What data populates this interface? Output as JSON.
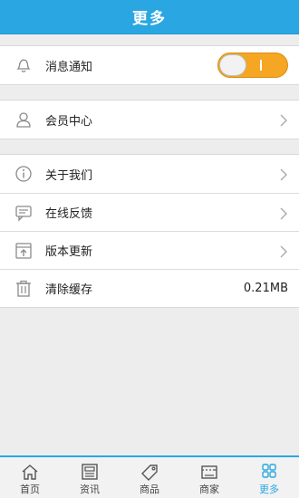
{
  "header": {
    "title": "更多"
  },
  "notifications": {
    "label": "消息通知",
    "toggle_on": true
  },
  "member": {
    "label": "会员中心"
  },
  "menu": [
    {
      "label": "关于我们",
      "icon": "info-icon"
    },
    {
      "label": "在线反馈",
      "icon": "feedback-icon"
    },
    {
      "label": "版本更新",
      "icon": "update-icon"
    }
  ],
  "cache": {
    "label": "清除缓存",
    "value": "0.21MB",
    "icon": "trash-icon"
  },
  "bottom_nav": [
    {
      "label": "首页",
      "icon": "home-icon",
      "active": false
    },
    {
      "label": "资讯",
      "icon": "news-icon",
      "active": false
    },
    {
      "label": "商品",
      "icon": "tag-icon",
      "active": false
    },
    {
      "label": "商家",
      "icon": "store-icon",
      "active": false
    },
    {
      "label": "更多",
      "icon": "more-grid-icon",
      "active": true
    }
  ],
  "colors": {
    "accent": "#2aa7e2",
    "toggle": "#f5a623"
  }
}
